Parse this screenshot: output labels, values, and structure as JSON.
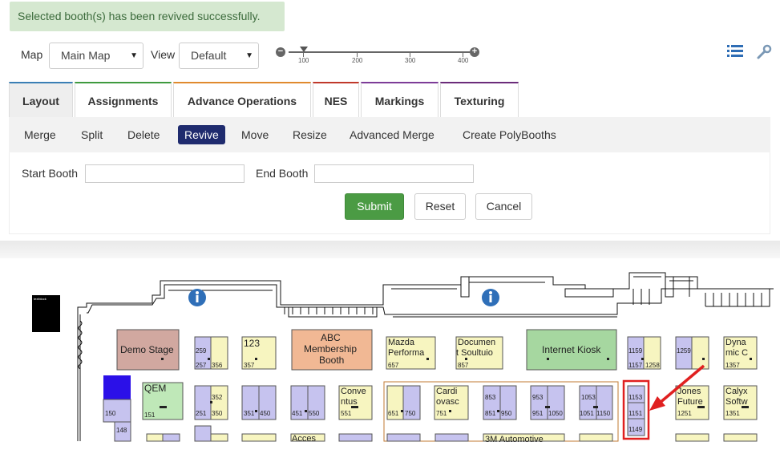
{
  "alert": {
    "message": "Selected booth(s) has been revived successfully."
  },
  "controls": {
    "map_label": "Map",
    "map_value": "Main Map",
    "view_label": "View",
    "view_value": "Default",
    "zoom": {
      "value": 100,
      "ticks": [
        "100",
        "200",
        "300",
        "400"
      ]
    }
  },
  "tabs": [
    {
      "label": "Layout",
      "active": true,
      "accent": "#3b7fb5"
    },
    {
      "label": "Assignments",
      "accent": "#3f9a3f"
    },
    {
      "label": "Advance Operations",
      "accent": "#e08a2e"
    },
    {
      "label": "NES",
      "accent": "#c0392b"
    },
    {
      "label": "Markings",
      "accent": "#7d3c98"
    },
    {
      "label": "Texturing",
      "accent": "#6b2c7a"
    }
  ],
  "subtabs": [
    "Merge",
    "Split",
    "Delete",
    "Revive",
    "Move",
    "Resize",
    "Advanced Merge",
    "Create PolyBooths"
  ],
  "active_subtab": "Revive",
  "form": {
    "start_label": "Start Booth",
    "end_label": "End Booth",
    "submit": "Submit",
    "reset": "Reset",
    "cancel": "Cancel"
  },
  "colors": {
    "selected_subtab": "#1f2b6e",
    "submit": "#4b9b44",
    "highlight": "#e02020"
  },
  "floorplan": {
    "small_label": "textblock",
    "booths": [
      {
        "id": "demo-stage",
        "lines": [
          "Demo Stage"
        ]
      },
      {
        "id": "b259",
        "nums": [
          "259",
          "257",
          "356"
        ]
      },
      {
        "id": "b123",
        "lines": [
          "123"
        ],
        "nums": [
          "357"
        ]
      },
      {
        "id": "abc",
        "lines": [
          "ABC",
          "Membership",
          "Booth"
        ]
      },
      {
        "id": "mazda",
        "lines": [
          "Mazda",
          "Performa"
        ],
        "nums": [
          "657"
        ]
      },
      {
        "id": "documen",
        "lines": [
          "Documen",
          "t Soultuio"
        ],
        "nums": [
          "857"
        ]
      },
      {
        "id": "kiosk",
        "lines": [
          "Internet Kiosk"
        ]
      },
      {
        "id": "b1159",
        "nums": [
          "1159",
          "1157",
          "1258"
        ]
      },
      {
        "id": "b1259",
        "nums": [
          "1259"
        ]
      },
      {
        "id": "dyna",
        "lines": [
          "Dyna",
          "mic C"
        ],
        "nums": [
          "1357"
        ]
      },
      {
        "id": "qem",
        "lines": [
          "QEM"
        ],
        "nums": [
          "151"
        ]
      },
      {
        "id": "b352",
        "nums": [
          "352",
          "251",
          "350"
        ]
      },
      {
        "id": "b351",
        "nums": [
          "351",
          "450"
        ]
      },
      {
        "id": "b451",
        "nums": [
          "451",
          "550"
        ]
      },
      {
        "id": "conve",
        "lines": [
          "Conve",
          "ntus"
        ],
        "nums": [
          "551"
        ]
      },
      {
        "id": "b651",
        "nums": [
          "651",
          "750"
        ]
      },
      {
        "id": "cardi",
        "lines": [
          "Cardi",
          "ovasc"
        ],
        "nums": [
          "751"
        ]
      },
      {
        "id": "b853",
        "nums": [
          "853",
          "851",
          "950"
        ]
      },
      {
        "id": "b953",
        "nums": [
          "953",
          "951",
          "1050"
        ]
      },
      {
        "id": "b1053",
        "nums": [
          "1053",
          "1051",
          "1150"
        ]
      },
      {
        "id": "b1153",
        "nums": [
          "1153",
          "1151",
          "1149"
        ]
      },
      {
        "id": "jones",
        "lines": [
          "Jones",
          "Future"
        ],
        "nums": [
          "1251"
        ]
      },
      {
        "id": "calyx",
        "lines": [
          "Calyx",
          "Softw"
        ],
        "nums": [
          "1351"
        ]
      },
      {
        "id": "b150",
        "nums": [
          "150",
          "148"
        ]
      },
      {
        "id": "acces",
        "lines": [
          "Acces"
        ]
      },
      {
        "id": "auto",
        "lines": [
          "3M Automotive"
        ]
      }
    ]
  }
}
